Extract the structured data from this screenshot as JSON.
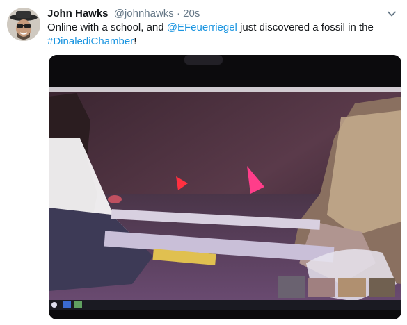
{
  "tweet": {
    "author": {
      "display_name": "John Hawks",
      "handle": "@johnhawks",
      "separator": "·",
      "time": "20s"
    },
    "text_parts": {
      "part1": "Online with a school, and ",
      "mention": "@EFeuerriegel",
      "part2": " just discovered a fossil in the",
      "hashtag": "#DinalediChamber",
      "part3": "!"
    },
    "icons": {
      "avatar": "profile-photo",
      "menu": "chevron-down-icon"
    },
    "colors": {
      "link": "#1b95e0",
      "text": "#14171a",
      "muted": "#657786"
    }
  }
}
